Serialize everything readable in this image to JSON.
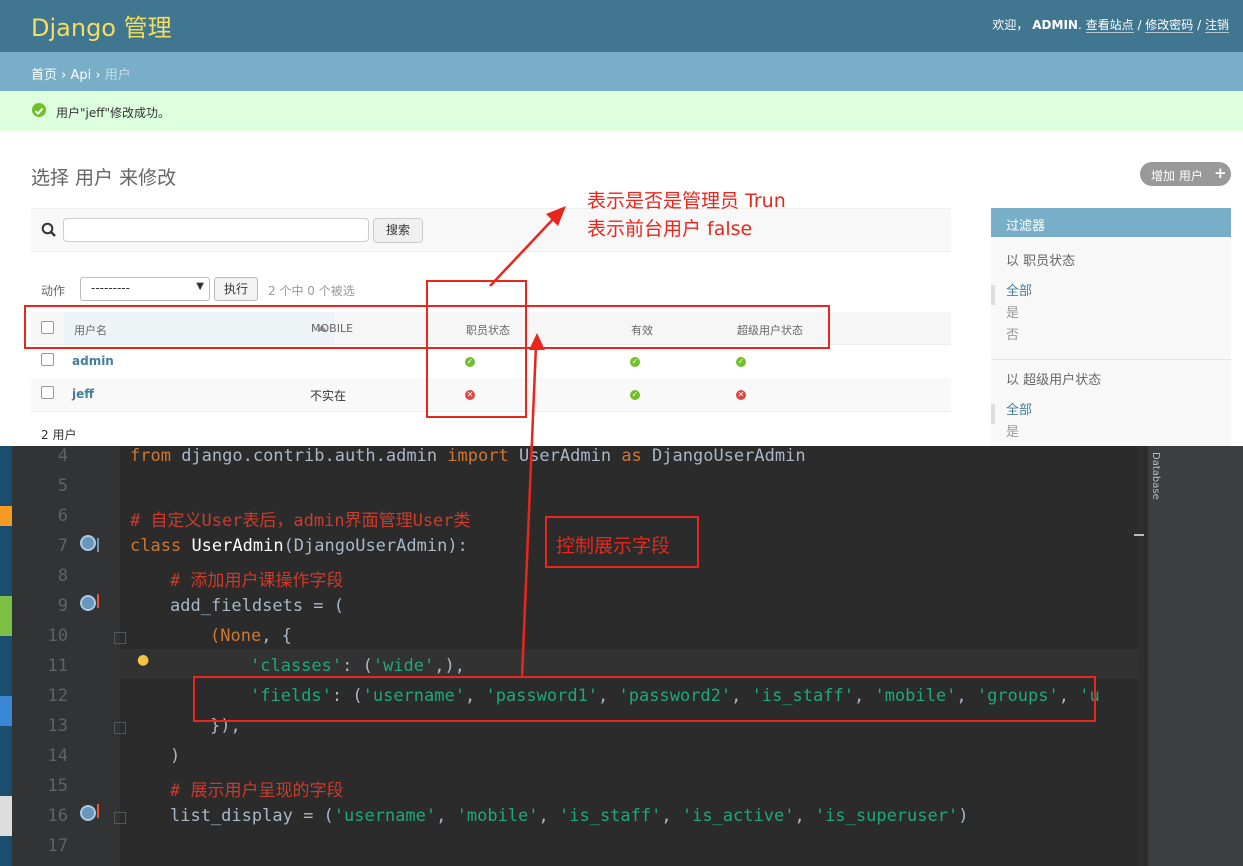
{
  "django": {
    "brand": "Django 管理",
    "usertools": {
      "welcome": "欢迎，",
      "user": "ADMIN",
      "view_site": "查看站点",
      "change_password": "修改密码",
      "logout": "注销",
      "sep": " / "
    },
    "breadcrumbs": {
      "home": "首页",
      "app": "Api",
      "current": "用户",
      "sep": " › "
    },
    "message": "用户\"jeff\"修改成功。",
    "title": "选择 用户 来修改",
    "add_button": "增加 用户",
    "search_button": "搜索",
    "search_value": "",
    "actions_label": "动作",
    "action_select_value": "---------",
    "go_button": "执行",
    "selection_counter": "2 个中 0 个被选",
    "columns": [
      "用户名",
      "MOBILE",
      "职员状态",
      "有效",
      "超级用户状态"
    ],
    "rows": [
      {
        "username": "admin",
        "mobile": "",
        "is_staff": true,
        "is_active": true,
        "is_superuser": true
      },
      {
        "username": "jeff",
        "mobile": "不实在",
        "is_staff": false,
        "is_active": true,
        "is_superuser": false
      }
    ],
    "row_count": "2 用户",
    "filter": {
      "title": "过滤器",
      "staff_heading": "以 职员状态",
      "staff_options": [
        "全部",
        "是",
        "否"
      ],
      "super_heading": "以 超级用户状态",
      "super_options": [
        "全部",
        "是"
      ]
    }
  },
  "annotations": {
    "admin_note_line1": "表示是否是管理员 Trun",
    "admin_note_line2": "表示前台用户  false",
    "fields_note": "控制展示字段",
    "color": "#e8261c"
  },
  "editor": {
    "lines": [
      {
        "n": "4"
      },
      {
        "n": "5"
      },
      {
        "n": "6"
      },
      {
        "n": "7"
      },
      {
        "n": "8"
      },
      {
        "n": "9"
      },
      {
        "n": "10"
      },
      {
        "n": "11"
      },
      {
        "n": "12"
      },
      {
        "n": "13"
      },
      {
        "n": "14"
      },
      {
        "n": "15"
      },
      {
        "n": "16"
      },
      {
        "n": "17"
      }
    ],
    "l4": {
      "from": "from",
      "mod": " django.contrib.auth.admin ",
      "imp": "import",
      "cls": " UserAdmin ",
      "as": "as",
      "alias": " DjangoUserAdmin"
    },
    "l6": "# 自定义User表后，admin界面管理User类",
    "l7": {
      "kw": "class",
      "name": "UserAdmin",
      "base": "(DjangoUserAdmin):"
    },
    "l8": "# 添加用户课操作字段",
    "l9": "add_fieldsets = (",
    "l10": {
      "none": "(None",
      "rest": ", {"
    },
    "l11": {
      "key": "'classes'",
      "mid": ": (",
      "val": "'wide'",
      "end": ",),"
    },
    "l12": {
      "key": "'fields'",
      "mid": ": (",
      "vals": [
        "'username'",
        "'password1'",
        "'password2'",
        "'is_staff'",
        "'mobile'",
        "'groups'",
        "'u"
      ]
    },
    "l13": "}),",
    "l14": ")",
    "l15": "# 展示用户呈现的字段",
    "l16": {
      "name": "list_display",
      "mid": " = (",
      "vals": [
        "'username'",
        "'mobile'",
        "'is_staff'",
        "'is_active'",
        "'is_superuser'"
      ],
      "end": ")"
    },
    "right_tool_label": "Database"
  },
  "colors": {
    "header": "#417690",
    "brand": "#f5dd5d",
    "breadcrumb": "#79aec8",
    "success_bg": "#dfd",
    "yes": "#70bf2b",
    "no": "#dd4646"
  }
}
